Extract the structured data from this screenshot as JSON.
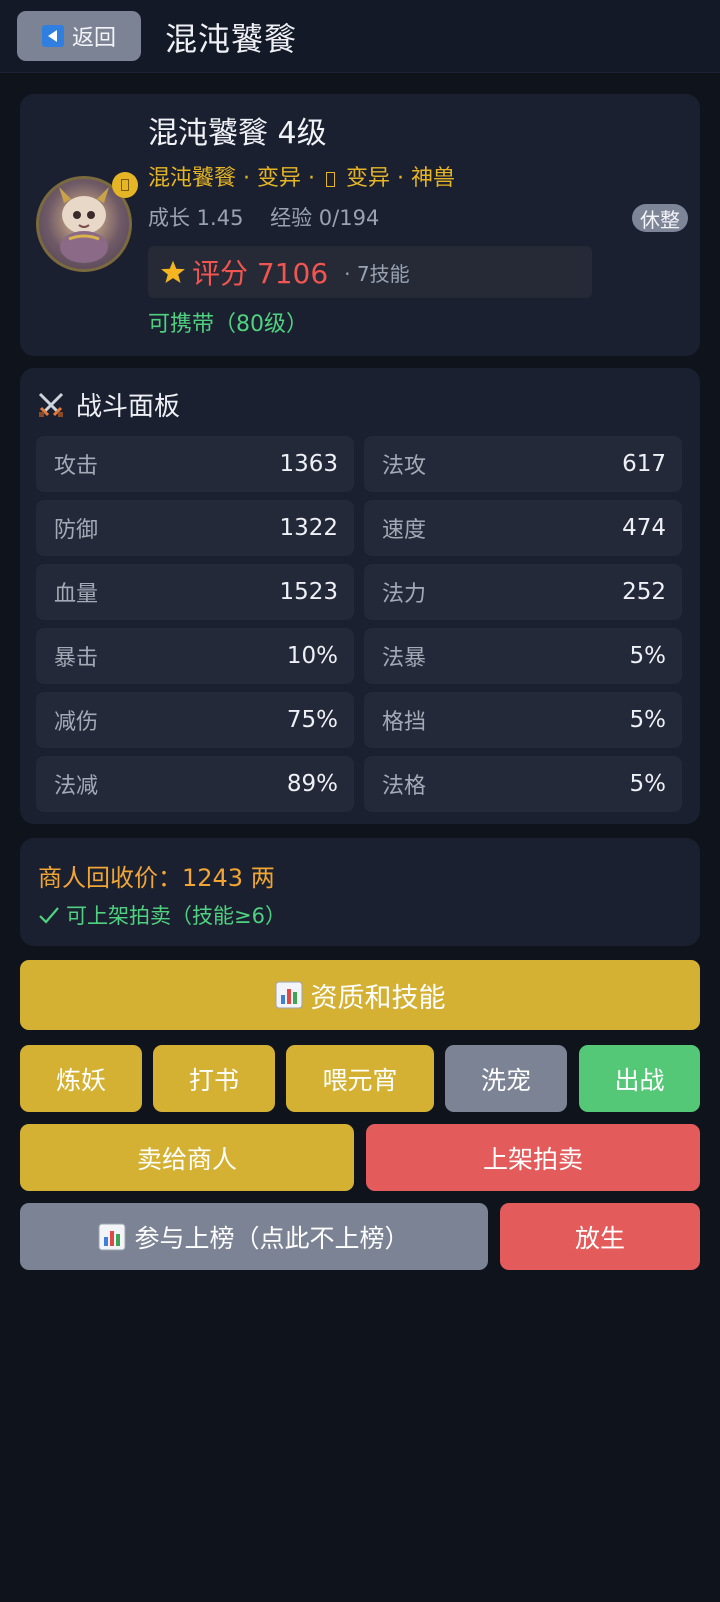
{
  "topbar": {
    "back_label": "返回",
    "title": "混沌饕餮"
  },
  "profile": {
    "name_level": "混沌饕餮  4级",
    "tag_name": "混沌饕餮",
    "tag_mutation": "变异",
    "tag_mutation2": "变异",
    "tag_rank": "神兽",
    "stats_line": "成长 1.45    经验 0/194",
    "status_badge": "休整",
    "score_label": "评分 7106",
    "skills_label": "· 7技能",
    "carry_label": "可携带（80级）"
  },
  "battle_panel": {
    "title": "战斗面板",
    "stats": [
      {
        "label": "攻击",
        "value": "1363"
      },
      {
        "label": "法攻",
        "value": "617"
      },
      {
        "label": "防御",
        "value": "1322"
      },
      {
        "label": "速度",
        "value": "474"
      },
      {
        "label": "血量",
        "value": "1523"
      },
      {
        "label": "法力",
        "value": "252"
      },
      {
        "label": "暴击",
        "value": "10%"
      },
      {
        "label": "法暴",
        "value": "5%"
      },
      {
        "label": "减伤",
        "value": "75%"
      },
      {
        "label": "格挡",
        "value": "5%"
      },
      {
        "label": "法减",
        "value": "89%"
      },
      {
        "label": "法格",
        "value": "5%"
      }
    ]
  },
  "price": {
    "recycle_label": "商人回收价：1243 两",
    "auction_label": "可上架拍卖（技能≥6）"
  },
  "actions": {
    "aptitude_skills": "资质和技能",
    "refine": "炼妖",
    "book": "打书",
    "feed": "喂元宵",
    "wash": "洗宠",
    "battle": "出战",
    "sell_merchant": "卖给商人",
    "list_auction": "上架拍卖",
    "ranking": "参与上榜（点此不上榜）",
    "release": "放生"
  },
  "colors": {
    "background": "#0f131c",
    "card": "#1a2030",
    "gold": "#d5b133",
    "gray_button": "#7b8395",
    "green": "#55c878",
    "red": "#e35b5a",
    "score_red": "#f0554f",
    "tag_yellow": "#e6b525",
    "carry_green": "#4fd17f",
    "price_orange": "#f0a535"
  },
  "icons": {
    "back": "back-arrow-icon",
    "star": "star-icon",
    "swords": "crossed-swords-icon",
    "check": "check-icon",
    "chart": "bar-chart-icon"
  }
}
